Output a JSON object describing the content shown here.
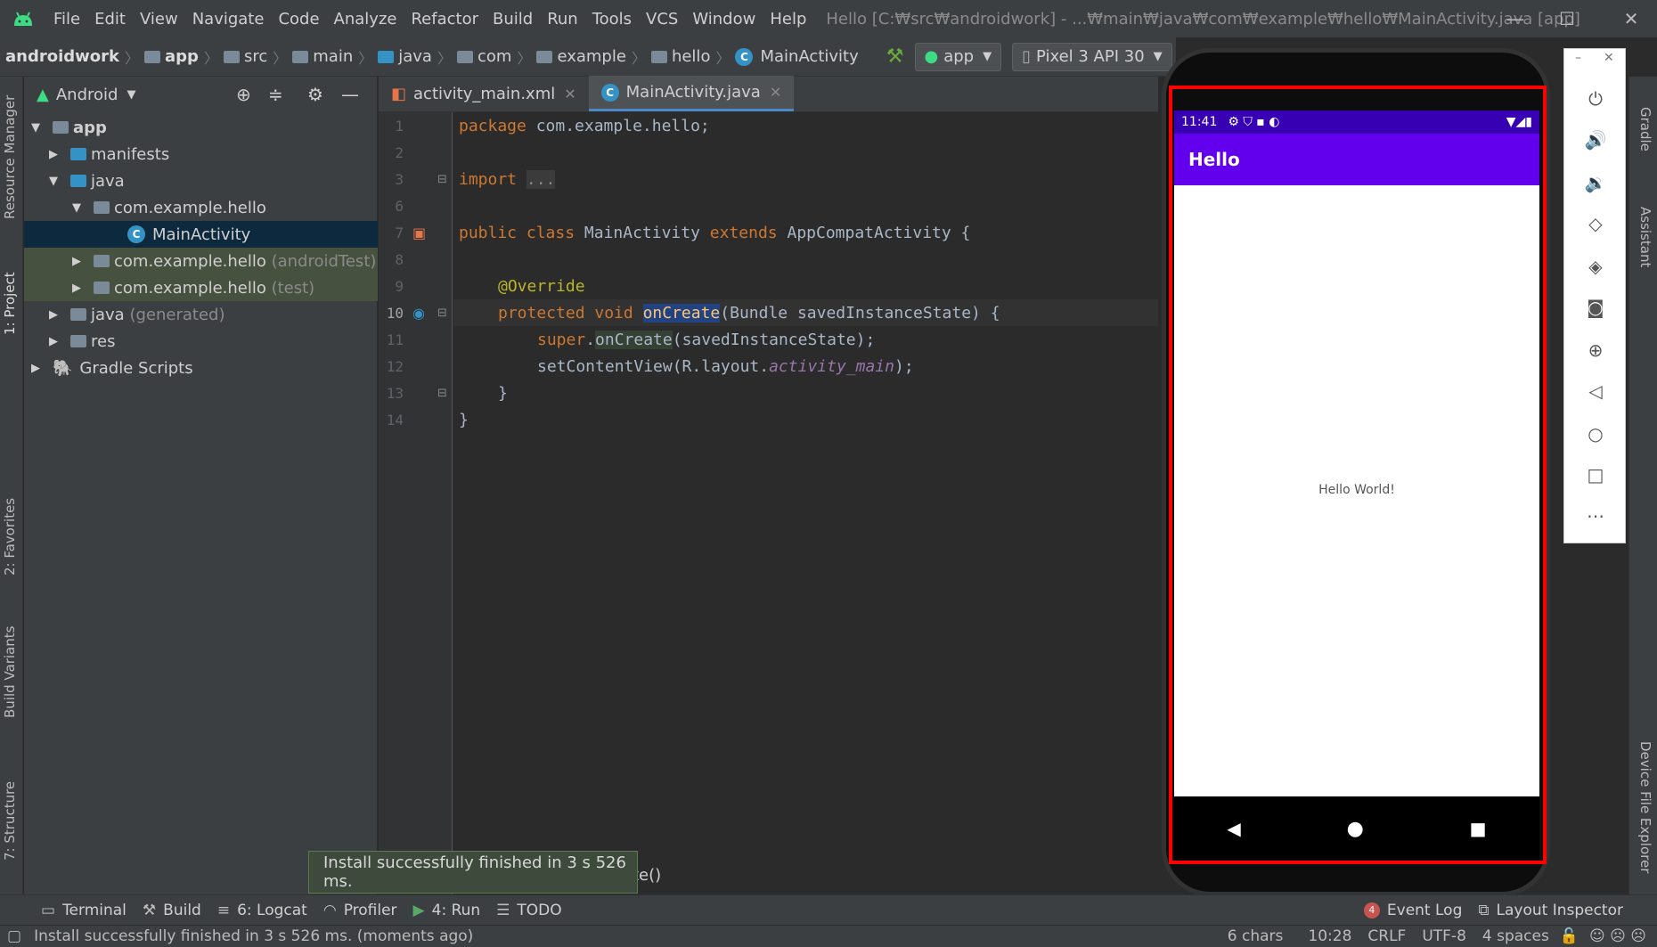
{
  "menu": {
    "items": [
      "File",
      "Edit",
      "View",
      "Navigate",
      "Code",
      "Analyze",
      "Refactor",
      "Build",
      "Run",
      "Tools",
      "VCS",
      "Window",
      "Help"
    ],
    "window_title": "Hello [C:₩src₩androidwork] - ...₩main₩java₩com₩example₩hello₩MainActivity.java [app]"
  },
  "breadcrumb": [
    "androidwork",
    "app",
    "src",
    "main",
    "java",
    "com",
    "example",
    "hello",
    "MainActivity"
  ],
  "run_config": "app",
  "device": "Pixel 3 API 30",
  "project_panel": {
    "view": "Android",
    "tree": [
      {
        "label": "app",
        "bold": true
      },
      {
        "label": "manifests"
      },
      {
        "label": "java"
      },
      {
        "label": "com.example.hello"
      },
      {
        "label": "MainActivity"
      },
      {
        "label": "com.example.hello",
        "suffix": "(androidTest)"
      },
      {
        "label": "com.example.hello",
        "suffix": "(test)"
      },
      {
        "label": "java",
        "suffix": "(generated)"
      },
      {
        "label": "res"
      },
      {
        "label": "Gradle Scripts"
      }
    ]
  },
  "left_tabs": [
    "Resource Manager",
    "1: Project",
    "2: Favorites",
    "Build Variants",
    "7: Structure"
  ],
  "right_tabs": [
    "Gradle",
    "Assistant",
    "Device File Explorer"
  ],
  "editor": {
    "tabs": [
      "activity_main.xml",
      "MainActivity.java"
    ],
    "active_tab": "MainActivity.java",
    "line_numbers": [
      "1",
      "2",
      "3",
      "6",
      "7",
      "8",
      "9",
      "10",
      "11",
      "12",
      "13",
      "14"
    ],
    "lines": {
      "l1a": "package ",
      "l1b": "com.example.hello;",
      "l3a": "import ",
      "l3b": "...",
      "l7a": "public class ",
      "l7b": "MainActivity ",
      "l7c": "extends ",
      "l7d": "AppCompatActivity {",
      "l9": "@Override",
      "l10a": "protected void ",
      "l10b": "onCreate",
      "l10c": "(Bundle savedInstanceState) {",
      "l11a": "super",
      ".l11b": "",
      "l11c": ".",
      "l11d": "onCreate",
      "l11e": "(savedInstanceState);",
      "l12a": "setContentView(R.layout.",
      "l12b": "activity_main",
      "l12c": ");",
      "l13": "}",
      "l14": "}"
    },
    "partial_hint": "te()"
  },
  "phone": {
    "time": "11:41",
    "app_title": "Hello",
    "content": "Hello World!"
  },
  "bottom_tools": [
    "Terminal",
    "Build",
    "6: Logcat",
    "Profiler",
    "4: Run",
    "TODO"
  ],
  "event_log": {
    "count": "4",
    "label": "Event Log"
  },
  "layout_inspector": "Layout Inspector",
  "balloon": "Install successfully finished in 3 s 526 ms.",
  "status": {
    "message": "Install successfully finished in 3 s 526 ms. (moments ago)",
    "chars": "6 chars",
    "position": "10:28",
    "line_sep": "CRLF",
    "encoding": "UTF-8",
    "indent": "4 spaces"
  }
}
